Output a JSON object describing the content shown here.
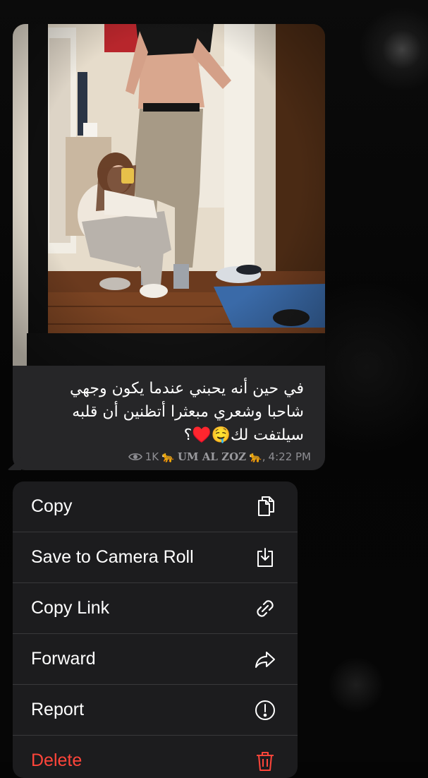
{
  "message": {
    "caption_lines": [
      "في حين أنه يحبني عندما يكون وجهي",
      "شاحبا وشعري مبعثرا أتظنين أن قلبه",
      "سيلتفت لك🤤♥️؟"
    ],
    "views": "1K",
    "signature_prefix_emoji": "🐆",
    "signature": "UM AL ZOZ",
    "signature_suffix_emoji": "🐆,",
    "time": "4:22 PM",
    "photo_icon": "mirror-selfie-photo"
  },
  "menu": {
    "items": [
      {
        "label": "Copy",
        "icon": "copy-icon"
      },
      {
        "label": "Save to Camera Roll",
        "icon": "download-icon"
      },
      {
        "label": "Copy Link",
        "icon": "link-icon"
      },
      {
        "label": "Forward",
        "icon": "forward-icon"
      },
      {
        "label": "Report",
        "icon": "report-icon"
      },
      {
        "label": "Delete",
        "icon": "trash-icon"
      }
    ]
  },
  "colors": {
    "bubble": "#262628",
    "menu": "#1c1c1e",
    "separator": "#38383a",
    "destructive": "#ff453a",
    "meta_text": "#8e8e93"
  }
}
